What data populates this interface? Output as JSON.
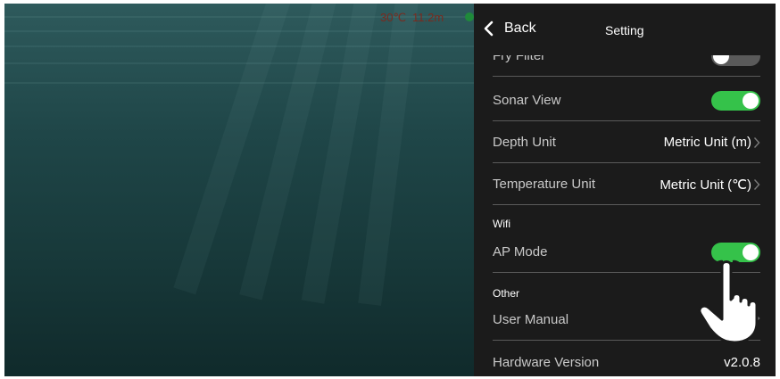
{
  "camera": {
    "temperature": "30℃",
    "depth": "11.2m"
  },
  "header": {
    "back_label": "Back",
    "title": "Setting"
  },
  "settings": {
    "fry_filter": {
      "label": "Fry Filter",
      "enabled": false
    },
    "sonar_view": {
      "label": "Sonar View",
      "enabled": true
    },
    "depth_unit": {
      "label": "Depth Unit",
      "value": "Metric Unit (m)"
    },
    "temperature_unit": {
      "label": "Temperature Unit",
      "value": "Metric Unit (℃)"
    },
    "wifi_section": "Wifi",
    "ap_mode": {
      "label": "AP Mode",
      "enabled": true
    },
    "other_section": "Other",
    "user_manual": {
      "label": "User Manual"
    },
    "hardware_version": {
      "label": "Hardware Version",
      "value": "v2.0.8"
    }
  },
  "colors": {
    "toggle_on": "#35c24a",
    "toggle_off": "#5a5a5a",
    "panel_bg": "#1b1b1b",
    "overlay_text": "#7a2a1e"
  },
  "icons": {
    "back": "chevron-left-icon",
    "row_arrow": "chevron-right-icon",
    "pointer": "hand-pointer-icon"
  }
}
